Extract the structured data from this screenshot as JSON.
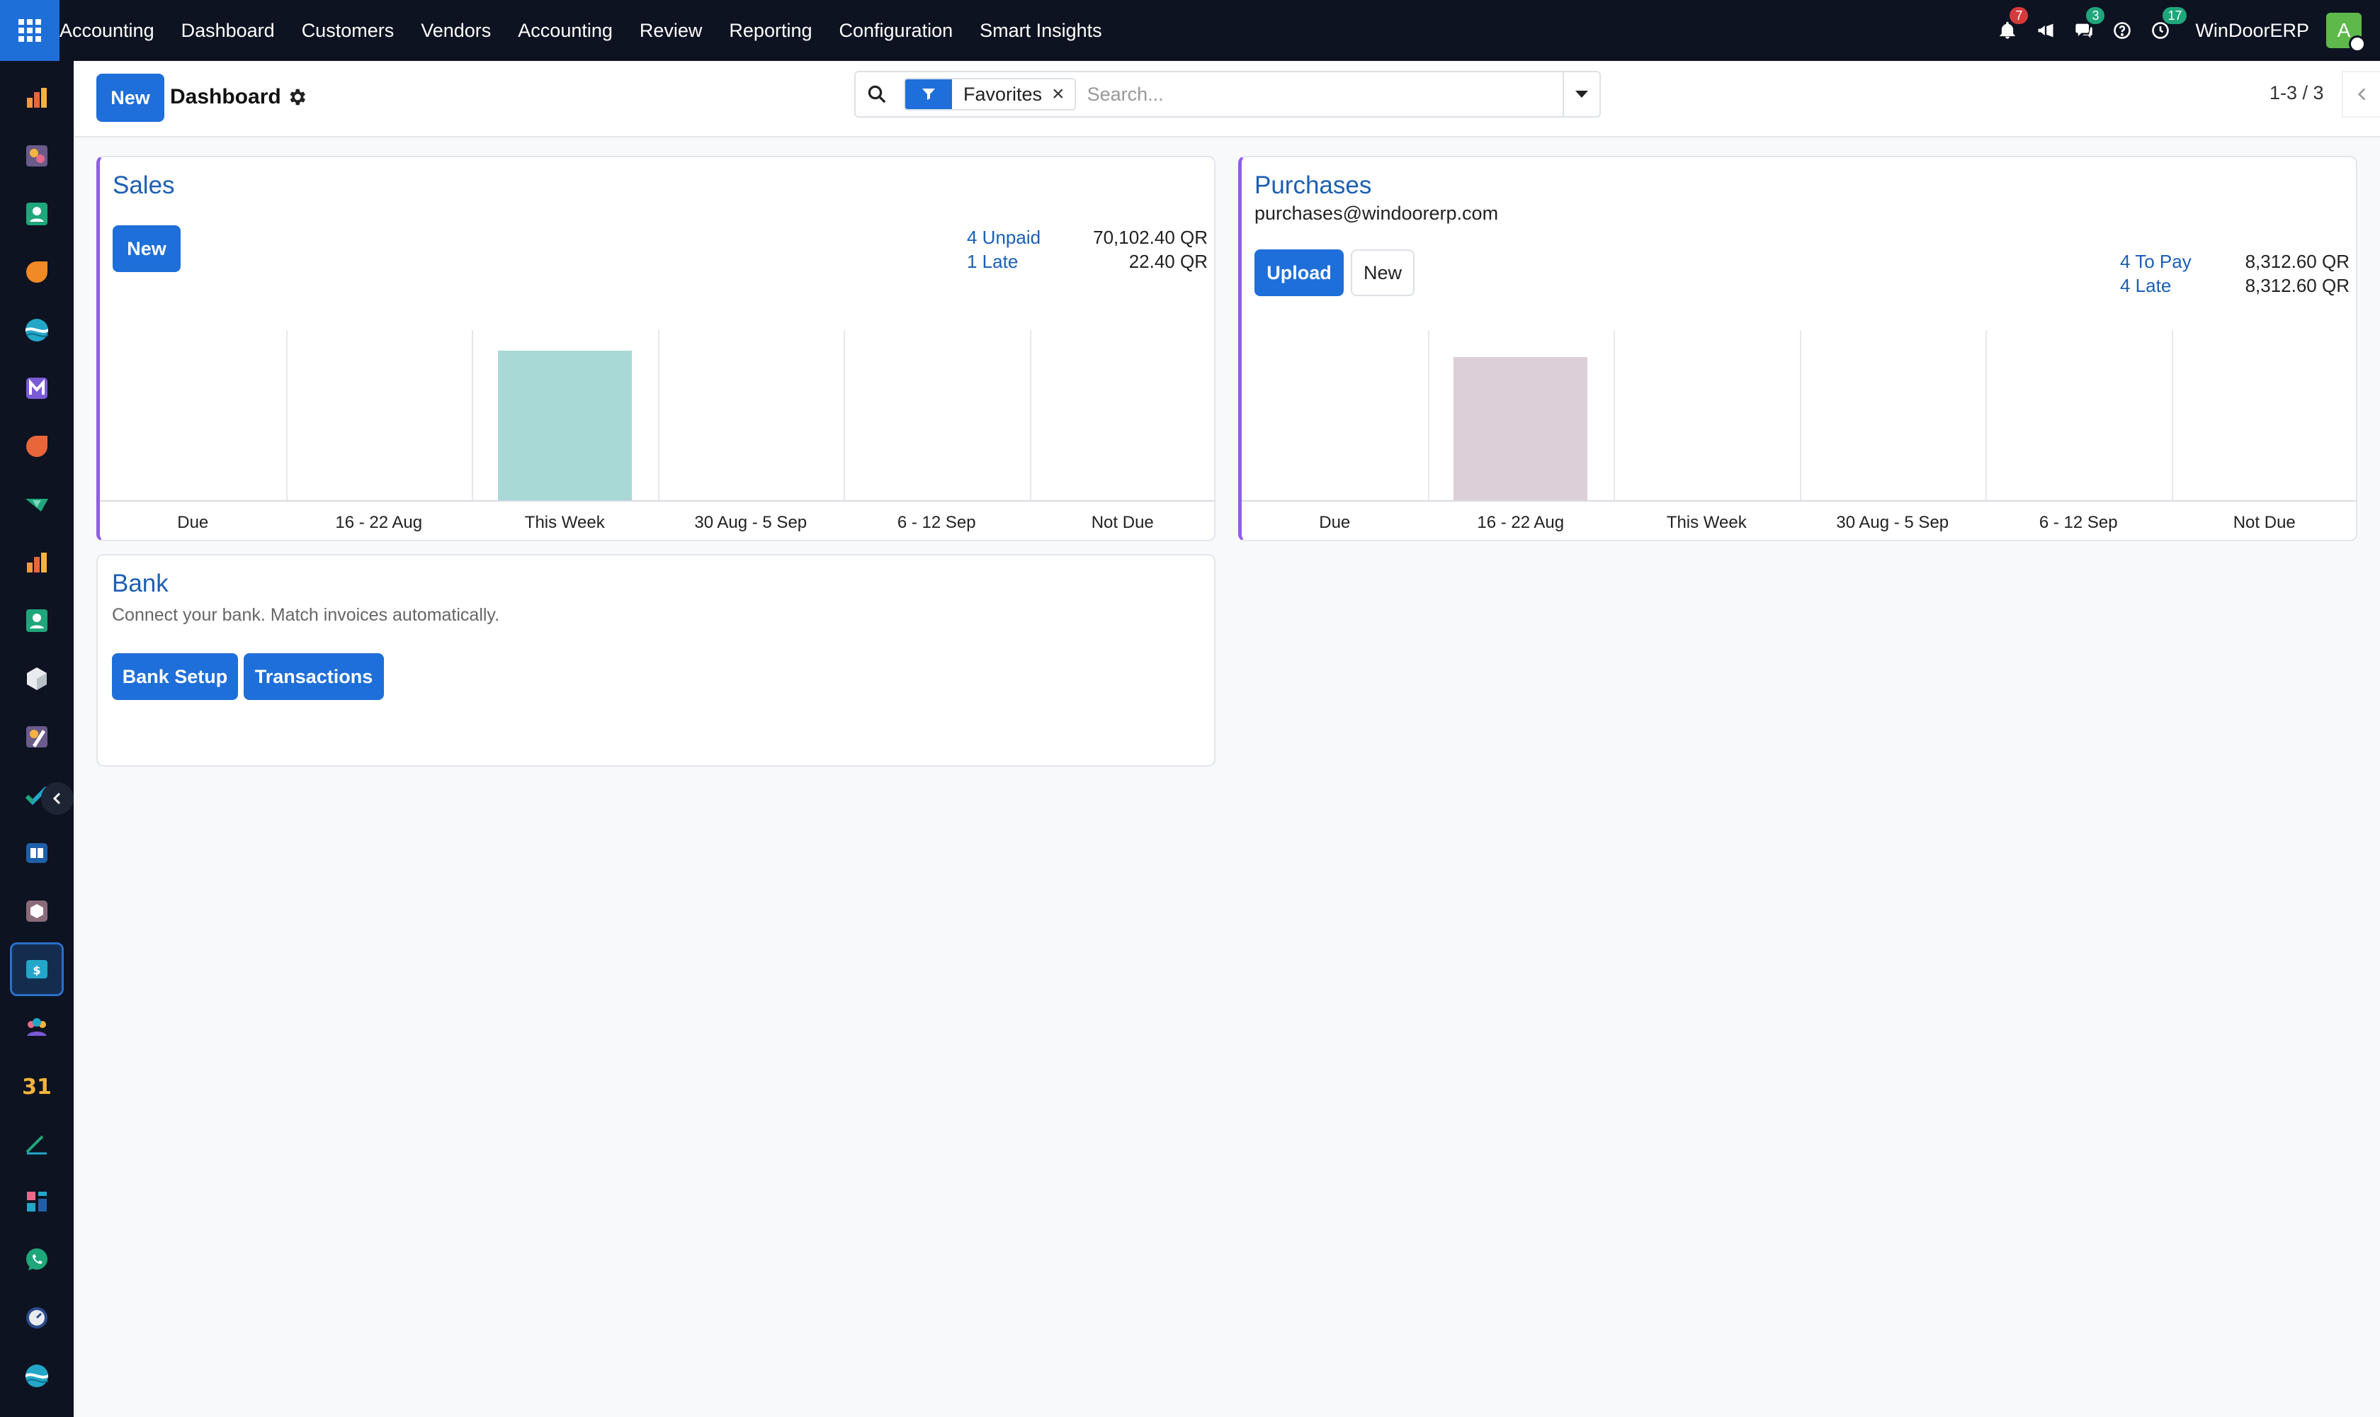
{
  "topbar": {
    "menu": [
      "Accounting",
      "Dashboard",
      "Customers",
      "Vendors",
      "Accounting",
      "Review",
      "Reporting",
      "Configuration",
      "Smart Insights"
    ],
    "notifications_badge": "7",
    "messages_badge": "3",
    "activities_badge": "17",
    "company": "WinDoorERP",
    "avatar_letter": "A"
  },
  "control": {
    "new_label": "New",
    "title": "Dashboard",
    "facet_label": "Favorites",
    "facet_remove": "×",
    "search_placeholder": "Search...",
    "pager": "1-3 / 3"
  },
  "sales": {
    "title": "Sales",
    "new_label": "New",
    "stats": [
      {
        "label": "4 Unpaid",
        "value": "70,102.40 QR"
      },
      {
        "label": "1 Late",
        "value": "22.40 QR"
      }
    ]
  },
  "purchases": {
    "title": "Purchases",
    "email": "purchases@windoorerp.com",
    "upload_label": "Upload",
    "new_label": "New",
    "stats": [
      {
        "label": "4 To Pay",
        "value": "8,312.60 QR"
      },
      {
        "label": "4 Late",
        "value": "8,312.60 QR"
      }
    ]
  },
  "bank": {
    "title": "Bank",
    "description": "Connect your bank. Match invoices automatically.",
    "setup_label": "Bank Setup",
    "transactions_label": "Transactions"
  },
  "colors": {
    "brand_blue": "#1e6fd9",
    "sales_bar": "#a8d9d6",
    "purchases_bar": "#dccfd8",
    "card_accent": "#8f5ee8"
  },
  "chart_data": [
    {
      "type": "bar",
      "title": "",
      "categories": [
        "Due",
        "16 - 22 Aug",
        "This Week",
        "30 Aug - 5 Sep",
        "6 - 12 Sep",
        "Not Due"
      ],
      "series": [
        {
          "values": [
            0,
            0,
            0.88,
            0,
            0,
            0
          ]
        }
      ],
      "ylim": [
        0,
        1
      ],
      "grid": true,
      "color": "#a8d9d6"
    },
    {
      "type": "bar",
      "title": "",
      "categories": [
        "Due",
        "16 - 22 Aug",
        "This Week",
        "30 Aug - 5 Sep",
        "6 - 12 Sep",
        "Not Due"
      ],
      "series": [
        {
          "values": [
            0,
            0.84,
            0,
            0,
            0,
            0
          ]
        }
      ],
      "ylim": [
        0,
        1
      ],
      "grid": true,
      "color": "#dccfd8"
    }
  ],
  "sidebar_icons": [
    "reporting-app-icon",
    "paint-app-icon",
    "contacts-app-icon",
    "discuss-app-icon",
    "website-app-icon",
    "email-marketing-app-icon",
    "livechat-app-icon",
    "sign-app-icon",
    "charts-app-icon",
    "employees-app-icon",
    "inventory-app-icon",
    "studio-app-icon",
    "project-app-icon",
    "knowledge-app-icon",
    "manufacturing-app-icon",
    "accounting-app-icon",
    "team-app-icon",
    "calendar-app-icon",
    "planning-app-icon",
    "dashboards-app-icon",
    "whatsapp-app-icon",
    "timesheets-app-icon",
    "website-2-app-icon"
  ],
  "calendar_glyph": "31"
}
